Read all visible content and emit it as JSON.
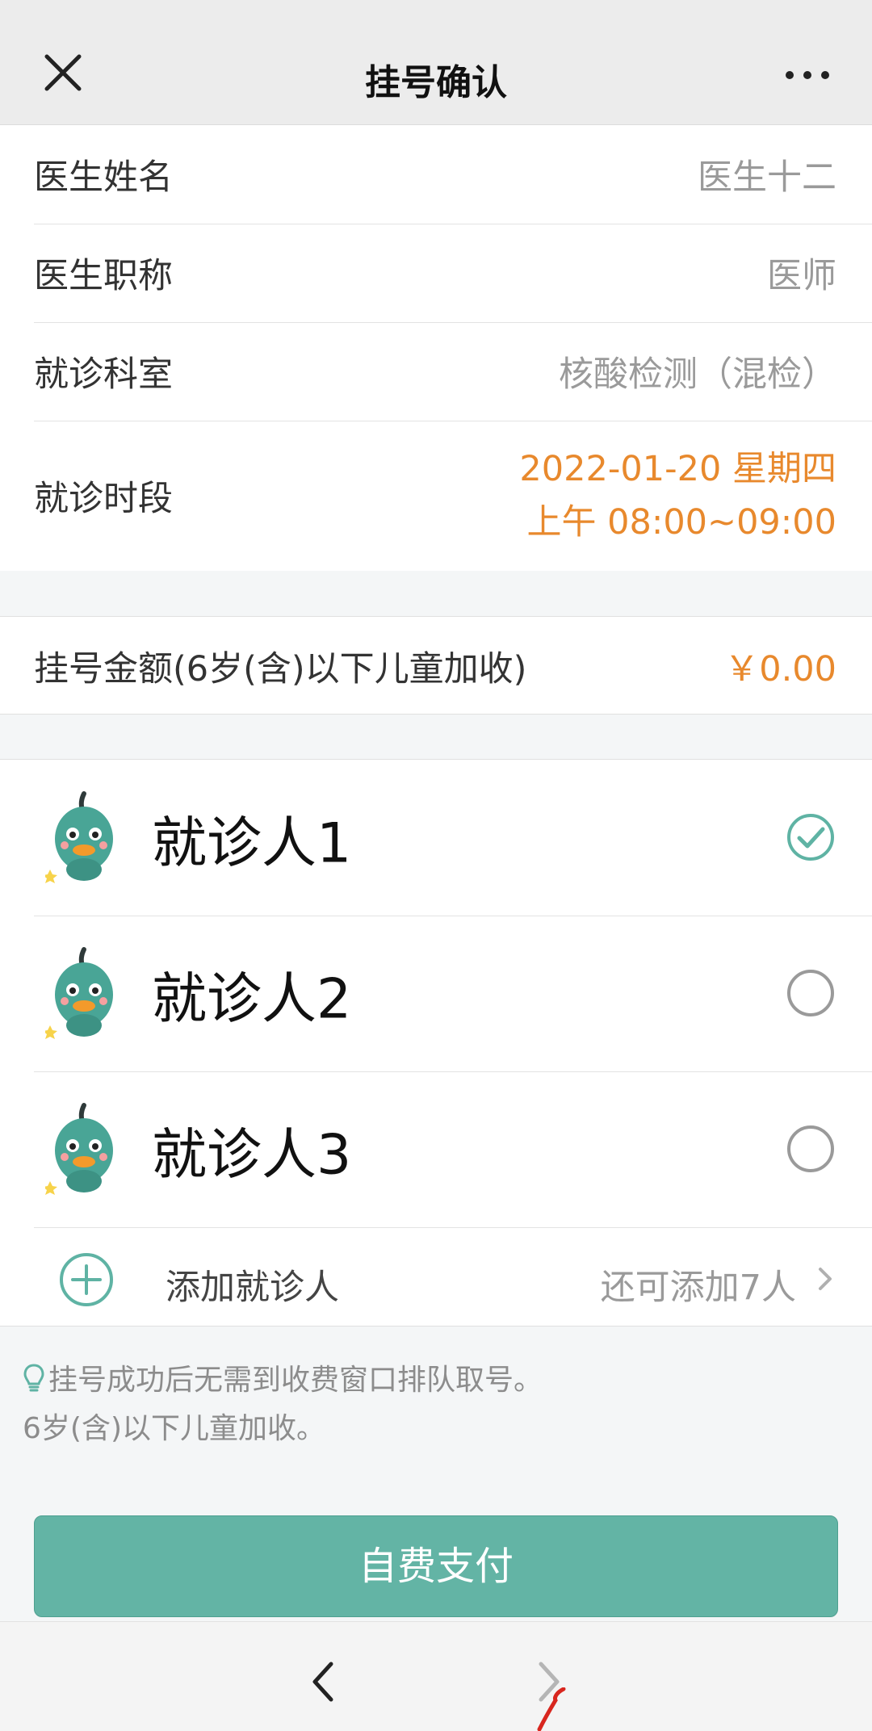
{
  "header": {
    "title": "挂号确认",
    "close_icon": "close-icon",
    "more_icon": "more-icon"
  },
  "info": {
    "doctor_name_label": "医生姓名",
    "doctor_name_value": "医生十二",
    "doctor_title_label": "医生职称",
    "doctor_title_value": "医师",
    "department_label": "就诊科室",
    "department_value": "核酸检测（混检）",
    "time_label": "就诊时段",
    "time_date": "2022-01-20 星期四",
    "time_slot": "上午 08:00~09:00"
  },
  "fee": {
    "label": "挂号金额(6岁(含)以下儿童加收)",
    "value": "￥0.00"
  },
  "patients": [
    {
      "name": "就诊人1",
      "selected": true
    },
    {
      "name": "就诊人2",
      "selected": false
    },
    {
      "name": "就诊人3",
      "selected": false
    }
  ],
  "add_patient": {
    "label": "添加就诊人",
    "remaining": "还可添加7人"
  },
  "tips": {
    "line1": "挂号成功后无需到收费窗口排队取号。",
    "line2": "6岁(含)以下儿童加收。"
  },
  "pay_button": "自费支付",
  "colors": {
    "accent": "#63b4a5",
    "orange": "#e8892d",
    "muted": "#9a9a9a"
  }
}
